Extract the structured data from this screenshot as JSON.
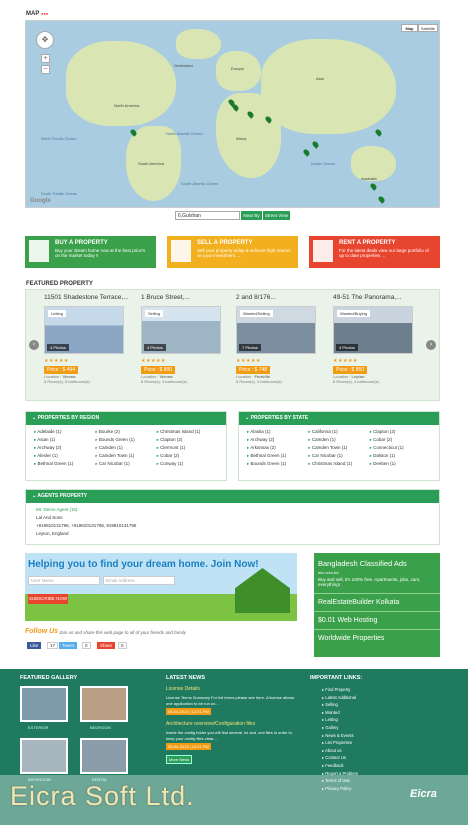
{
  "map": {
    "title": "MAP",
    "zoom_plus": "+",
    "zoom_minus": "−",
    "map_btn": "Map",
    "sat_btn": "Satellite",
    "google": "Google",
    "search_value": "6,Gulshan",
    "nearby_btn": "Near By",
    "street_btn": "Street View",
    "labels": [
      "Greenland",
      "North America",
      "North Pacific Ocean",
      "North Atlantic Ocean",
      "South America",
      "South Atlantic Ocean",
      "Africa",
      "Europe",
      "Asia",
      "Indian Ocean",
      "Australia",
      "South Pacific Ocean"
    ]
  },
  "boxes": [
    {
      "title": "BUY A PROPERTY",
      "text": "Buy your dream home now at the best price's on the market today !!",
      "color": "#3aa04a"
    },
    {
      "title": "SELL A PROPERTY",
      "text": "Sell your property today & achieve high returns on your investment ....",
      "color": "#f2b01e"
    },
    {
      "title": "RENT A PROPERTY",
      "text": "For the latest deals view our large portfolio of up to date properties ...",
      "color": "#e8452e"
    }
  ],
  "featured": {
    "title": "FEATURED PROPERTY",
    "cards": [
      {
        "title": "11501 Shadestone Terrace,...",
        "tag": "Letting",
        "photos": "4 Photos",
        "stars": "★★★★★",
        "price": "Price : $ 494",
        "location": "Vienna",
        "rooms": "5 Room(s), 5 bathroom(s)",
        "img": "#8aa6c4"
      },
      {
        "title": "1 Bruce Street,...",
        "tag": "Selling",
        "photos": "4 Photos",
        "stars": "★★★★★",
        "price": "Price : $ 800",
        "location": "Vienna",
        "rooms": "8 Room(s), 4 bathroom(s)",
        "img": "#9eb5c6"
      },
      {
        "title": "2 and 8/176...",
        "tag": "Wanted/Selling",
        "photos": "7 Photos",
        "stars": "★★★★★",
        "price": "Price : $ 748",
        "location": "Fortville",
        "rooms": "6 Room(s), 4 bathroom(s)",
        "img": "#7b8fa0"
      },
      {
        "title": "49-51 The Panorama,...",
        "tag": "Wanted/Buying",
        "photos": "4 Photos",
        "stars": "★★★★★",
        "price": "Price : $ 850",
        "location": "Leyton",
        "rooms": "6 Room(s), 4 bathroom(s)",
        "img": "#6d7f8f"
      }
    ]
  },
  "region": {
    "title": "PROPERTIES BY REGION",
    "items": [
      "Adelaide (1)",
      "Bourke (2)",
      "Christmas Island (1)",
      "Asian (1)",
      "Bounds Green (1)",
      "Clapton (2)",
      "Archway (2)",
      "Camden (1)",
      "Clermont (1)",
      "Alexler (1)",
      "Camden Town (1)",
      "Cobar (2)",
      "Bethnal Green (1)",
      "Car Nicobar (1)",
      "Conway (1)"
    ]
  },
  "state": {
    "title": "PROPERTIES BY STATE",
    "items": [
      "Alaska (1)",
      "California (1)",
      "Clapton (2)",
      "Archway (2)",
      "Camden (1)",
      "Cobar (2)",
      "Arkansas (2)",
      "Camden Town (1)",
      "Connecticut (1)",
      "Bethnal Green (1)",
      "Car Nicobar (1)",
      "Dalston (1)",
      "Bounds Green (1)",
      "Christmas Island (1)",
      "Deeben (1)"
    ]
  },
  "agents": {
    "title": "AGENTS PROPERTY",
    "name": "Mr. Demo Agent (15)",
    "company": "Lal And Sons",
    "phones": "+919810131796, +919810131796, 919810131796",
    "address": "Leyton, England"
  },
  "banner": {
    "headline": "Helping you to find your dream home. Join Now!",
    "user_ph": "User Name",
    "email_ph": "Email Address",
    "subscribe": "SUBSCRIBE NOW"
  },
  "follow": {
    "title": "Follow Us",
    "text": "Join us and share this web page to all of your friends and family",
    "like": "Like",
    "like_count": "17",
    "tweet": "Tweet",
    "tweet_count": "0",
    "share": "Share",
    "share_count": "0"
  },
  "ad": {
    "title": "Bangladesh Classified Ads",
    "url": "ekc.com.bd",
    "text": "Buy and sell, it's 100% free. Apartments, jobs, cars, everything!",
    "links": [
      "RealEstateBuilder Kolkata",
      "$0.01 Web Hosting",
      "Worldwide Properties"
    ]
  },
  "footer": {
    "gallery_title": "FEATURED GALLERY",
    "gallery": [
      "EXTERIOR",
      "BEDROOM",
      "BATHROOM",
      "RENTAL"
    ],
    "news_title": "LATEST NEWS",
    "news": [
      {
        "h": "License Details",
        "t": "License Terms Summary   For full terms please see here. A license allows one application to be run on...",
        "d": "05-04-2013 | 12:21 PM"
      },
      {
        "h": "Architecture overview/Configuration files",
        "t": "Inside the config folder you will find several .ini and .xml files in order to keep your config files clear....",
        "d": "05-04-2013 | 12:21 PM"
      }
    ],
    "more_news": "More News",
    "links_title": "IMPORTANT LINKS:",
    "links": [
      "Find Property",
      "Latest Additional",
      "Selling",
      "Wanted",
      "Letting",
      "Gallery",
      "News & Events",
      "List Properties",
      "About us",
      "Contact Us",
      "Feedback",
      "Report a Problem",
      "Terms of Use",
      "Privacy Policy"
    ]
  },
  "watermark": "Eicra Soft Ltd.",
  "logo": "Eicra"
}
